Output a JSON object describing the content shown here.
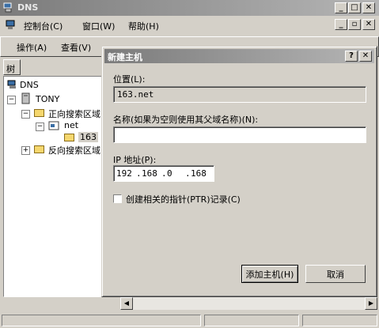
{
  "window": {
    "title": "DNS"
  },
  "menubar": {
    "items": [
      "控制台(C)",
      "窗口(W)",
      "帮助(H)"
    ]
  },
  "toolbar": {
    "action_label": "操作(A)",
    "view_label": "查看(V)"
  },
  "tree": {
    "tab_label": "树",
    "root": "DNS",
    "server": "TONY",
    "forward_zone": "正向搜索区域",
    "net_zone": "net",
    "sub_163": "163",
    "reverse_zone": "反向搜索区域"
  },
  "dialog": {
    "title": "新建主机",
    "location_label": "位置(L):",
    "location_value": "163.net",
    "name_label": "名称(如果为空则使用其父域名称)(N):",
    "name_value": "",
    "ip_label": "IP 地址(P):",
    "ip_octets": [
      "192",
      "168",
      "0",
      "168"
    ],
    "ptr_label": "创建相关的指针(PTR)记录(C)",
    "ptr_checked": false,
    "add_button": "添加主机(H)",
    "cancel_button": "取消"
  }
}
